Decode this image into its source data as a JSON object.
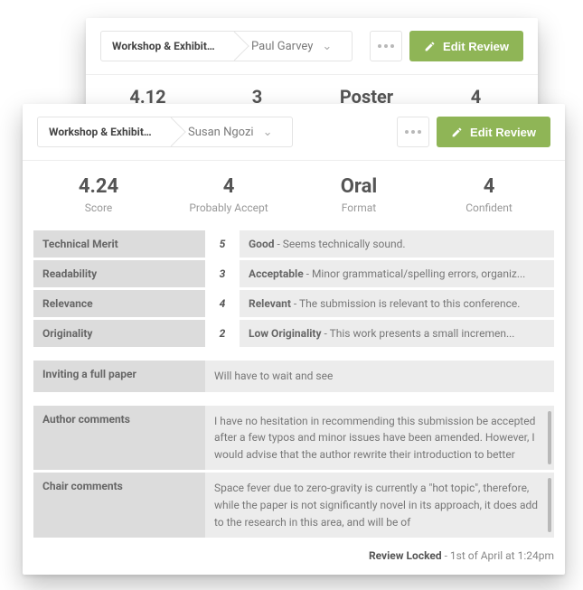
{
  "colors": {
    "accent": "#8fb556"
  },
  "back_card": {
    "breadcrumb": {
      "section": "Workshop & Exhibitor...",
      "reviewer": "Paul Garvey"
    },
    "buttons": {
      "edit": "Edit Review"
    },
    "stats": [
      {
        "value": "4.12"
      },
      {
        "value": "3"
      },
      {
        "value": "Poster"
      },
      {
        "value": "4"
      }
    ]
  },
  "front_card": {
    "breadcrumb": {
      "section": "Workshop & Exhibitor...",
      "reviewer": "Susan Ngozi"
    },
    "buttons": {
      "edit": "Edit Review"
    },
    "stats": [
      {
        "value": "4.24",
        "label": "Score"
      },
      {
        "value": "4",
        "label": "Probably Accept"
      },
      {
        "value": "Oral",
        "label": "Format"
      },
      {
        "value": "4",
        "label": "Confident"
      }
    ],
    "criteria": [
      {
        "label": "Technical Merit",
        "score": "5",
        "term": "Good",
        "desc": " - Seems technically sound."
      },
      {
        "label": "Readability",
        "score": "3",
        "term": "Acceptable",
        "desc": " - Minor grammatical/spelling errors, organiz..."
      },
      {
        "label": "Relevance",
        "score": "4",
        "term": "Relevant",
        "desc": " - The submission is relevant to this conference."
      },
      {
        "label": "Originality",
        "score": "2",
        "term": "Low Originality",
        "desc": " - This work presents a small incremen..."
      }
    ],
    "short_answer": {
      "label": "Inviting a full paper",
      "body": "Will have to wait and see"
    },
    "long_answers": [
      {
        "label": "Author comments",
        "body": "I have no hesitation in recommending this submission be accepted after a few typos and minor issues have been amended. However, I would advise that the author rewrite their introduction to better"
      },
      {
        "label": "Chair comments",
        "body": "Space fever due to zero-gravity is currently a \"hot topic\", therefore, while the paper is not significantly novel in its approach, it does add to the research in this area, and will be of"
      }
    ],
    "locked": {
      "label": "Review Locked",
      "time": " - 1st of April at 1:24pm"
    }
  }
}
